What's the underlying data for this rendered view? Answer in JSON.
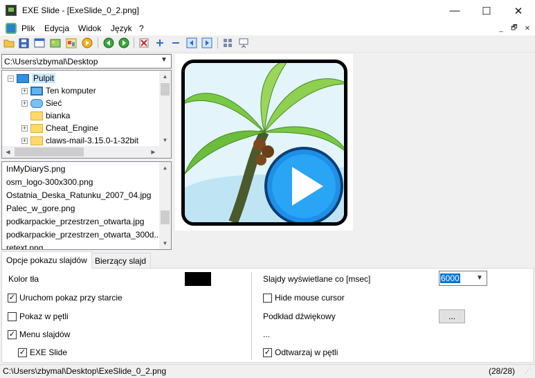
{
  "window": {
    "title": "EXE Slide - [ExeSlide_0_2.png]",
    "minimize_glyph": "—",
    "maximize_glyph": "☐",
    "close_glyph": "✕"
  },
  "menu": {
    "items": [
      "Plik",
      "Edycja",
      "Widok",
      "Język",
      "?"
    ],
    "mdi": [
      "_",
      "🗗",
      "✕"
    ]
  },
  "toolbar": {
    "icons": [
      "open-folder-icon",
      "save-icon",
      "window-icon",
      "image-edit-icon",
      "gallery-icon",
      "play-icon",
      "prev-green-icon",
      "next-green-icon",
      "delete-image-icon",
      "zoom-in-icon",
      "zoom-out-icon",
      "previous-icon",
      "next-icon",
      "thumbnails-icon",
      "slideshow-icon"
    ]
  },
  "path_combo": {
    "value": "C:\\Users\\zbymal\\Desktop"
  },
  "tree": {
    "items": [
      {
        "label": "Pulpit",
        "type": "desktop",
        "expander": "−",
        "selected": true
      },
      {
        "label": "Ten komputer",
        "type": "computer",
        "expander": "+"
      },
      {
        "label": "Sieć",
        "type": "network",
        "expander": "+"
      },
      {
        "label": "bianka",
        "type": "folder",
        "expander": ""
      },
      {
        "label": "Cheat_Engine",
        "type": "folder",
        "expander": "+"
      },
      {
        "label": "claws-mail-3.15.0-1-32bit",
        "type": "folder",
        "expander": "+"
      }
    ]
  },
  "files": {
    "items": [
      "InMyDiaryS.png",
      "osm_logo-300x300.png",
      "Ostatnia_Deska_Ratunku_2007_04.jpg",
      "Palec_w_gore.png",
      "podkarpackie_przestrzen_otwarta.jpg",
      "podkarpackie_przestrzen_otwarta_300d...",
      "retext.png"
    ]
  },
  "tabs": [
    "Opcje pokazu slajdów",
    "Bierzący slajd"
  ],
  "options": {
    "color_label": "Kolor tła",
    "color_value": "#000000",
    "start_label": "Uruchom pokaz przy starcie",
    "start_checked": true,
    "loop_label": "Pokaz w pętli",
    "loop_checked": false,
    "menu_label": "Menu slajdów",
    "menu_checked": true,
    "exe_label": "EXE Slide",
    "exe_checked": true,
    "duration_label": "Slajdy wyświetlane co  [msec]",
    "duration_value": "6000",
    "hide_cursor_label": "Hide mouse cursor",
    "hide_cursor_checked": false,
    "sound_label": "Podkład dźwiękowy",
    "sound_button": "...",
    "sound_value": "...",
    "play_loop_label": "Odtwarzaj w pętli",
    "play_loop_checked": true
  },
  "status": {
    "path": "C:\\Users\\zbymal\\Desktop\\ExeSlide_0_2.png",
    "count": "(28/28)"
  },
  "colors": {
    "selection": "#0078d7",
    "tree_selection": "#cce8ff",
    "play_button": "#1e90e8"
  }
}
